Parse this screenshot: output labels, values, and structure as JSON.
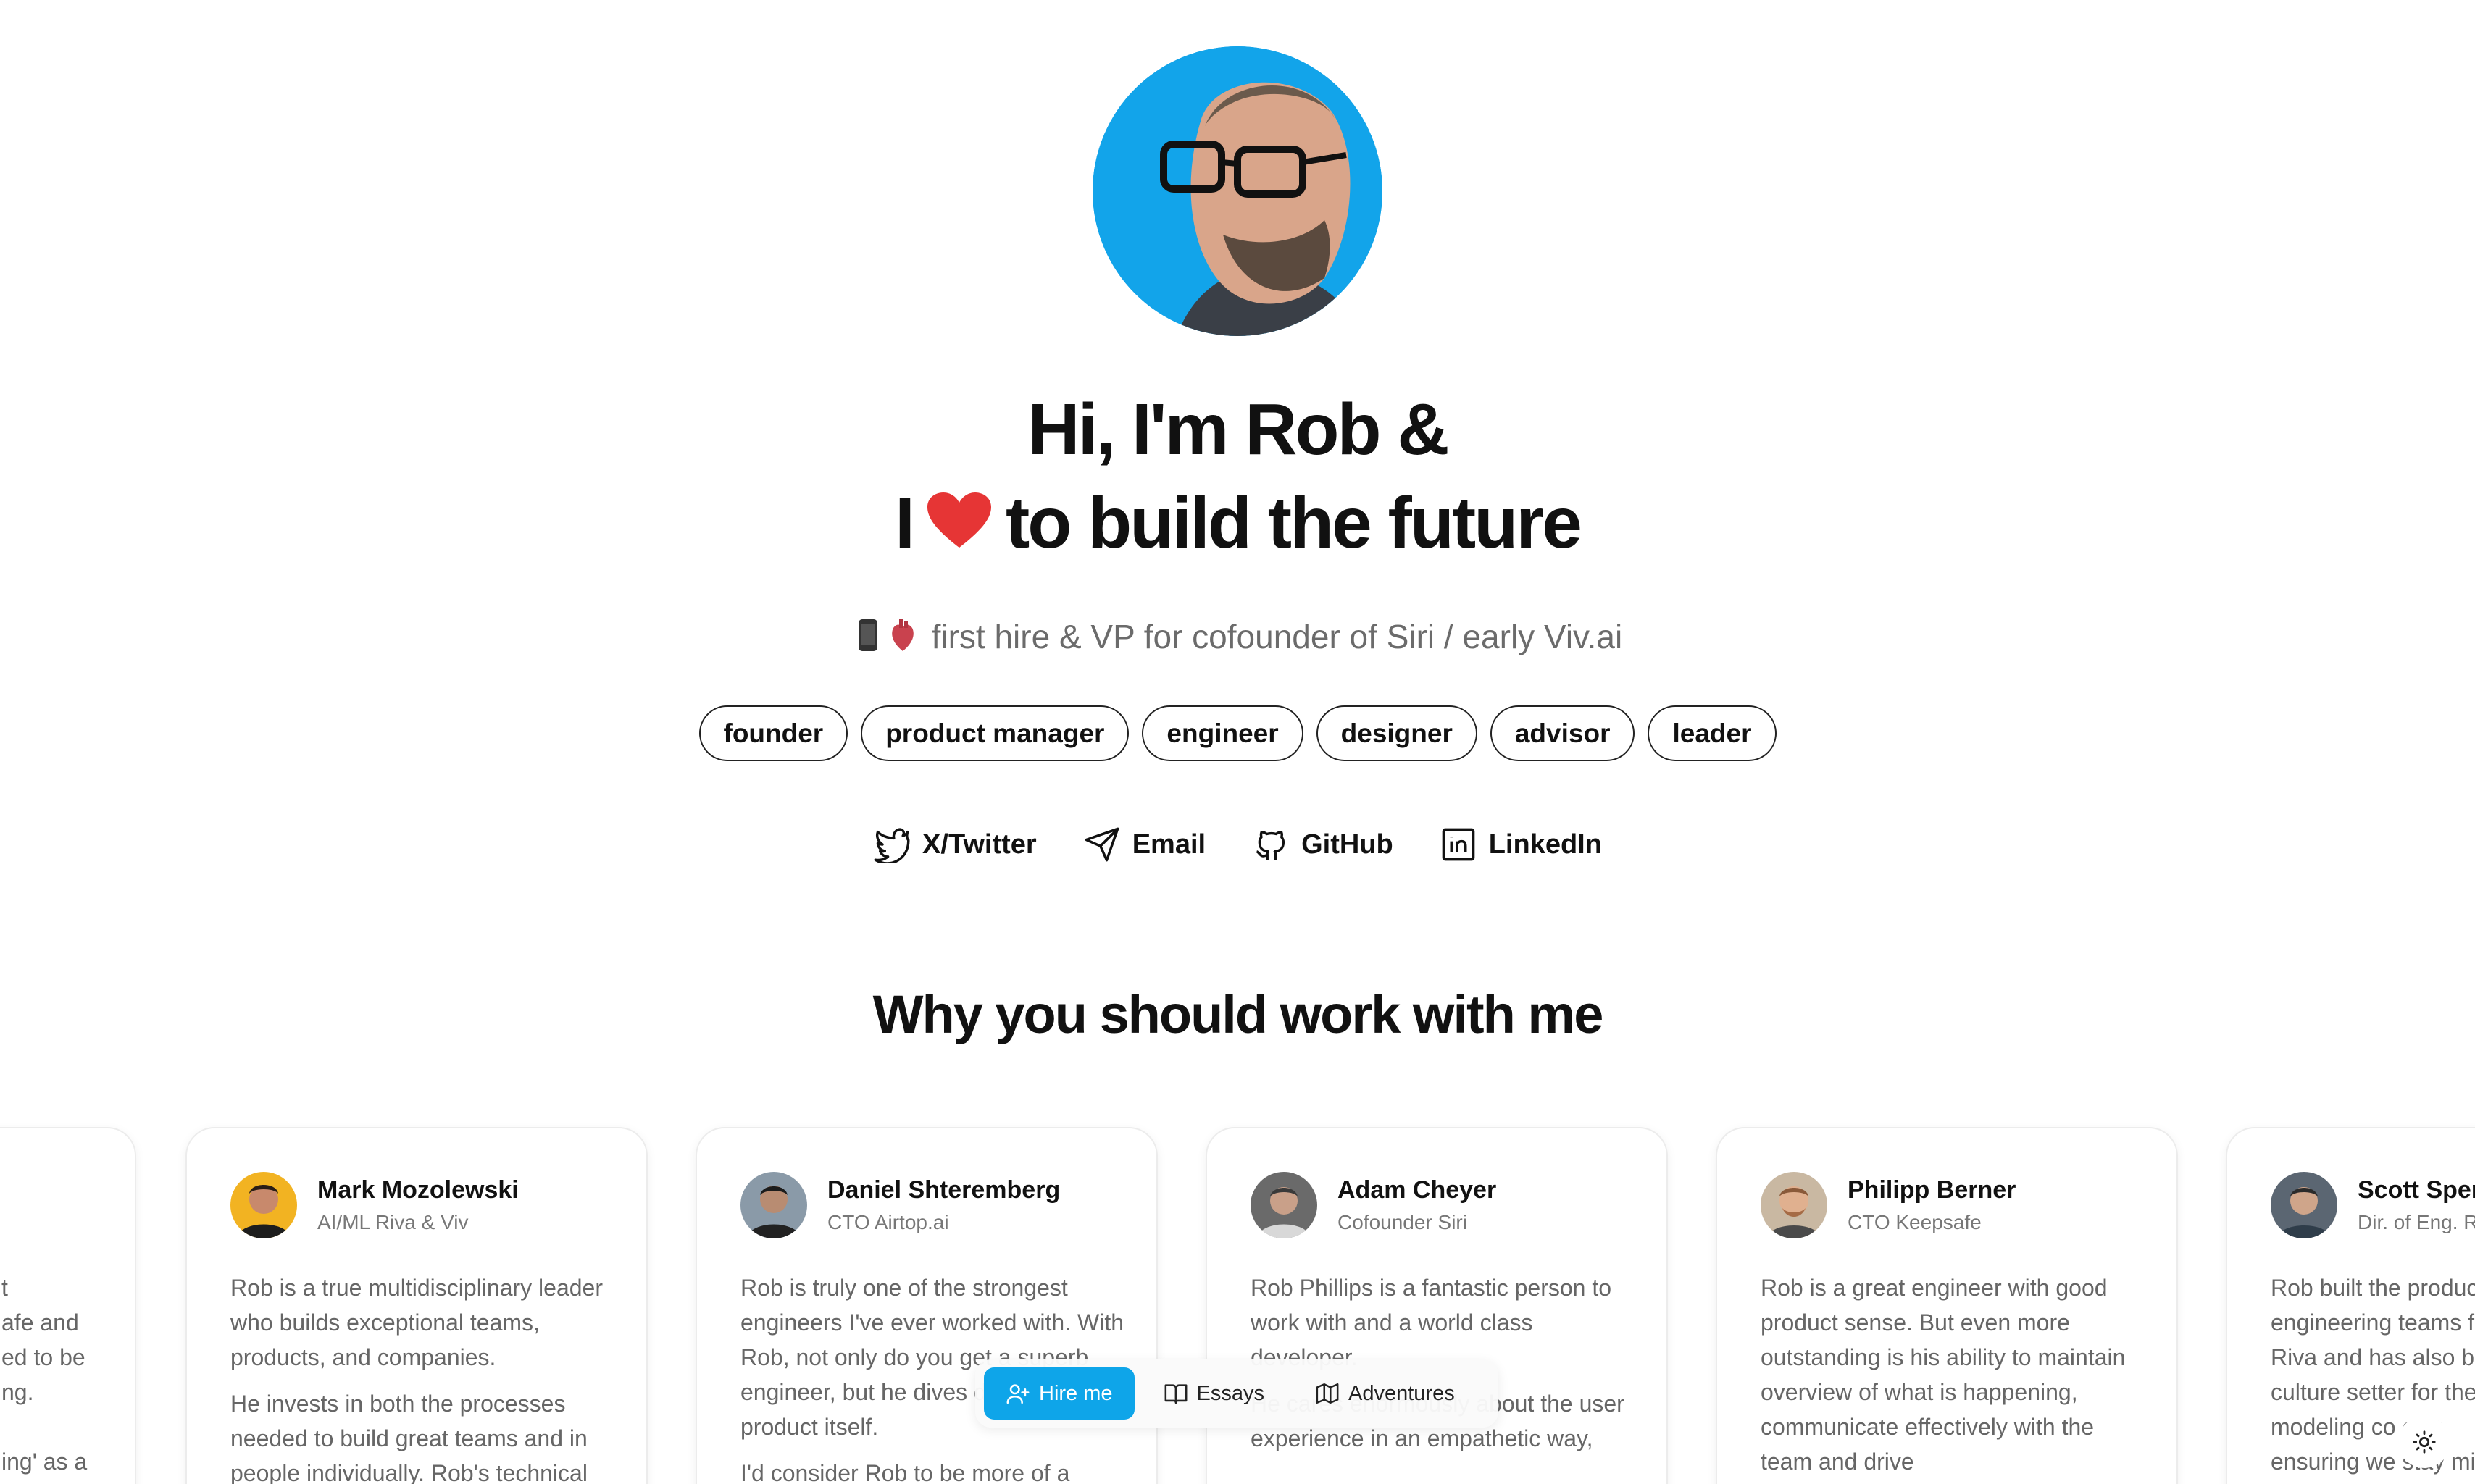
{
  "hero": {
    "headline_line1": "Hi, I'm Rob &",
    "headline_line2_start": "I",
    "headline_line2_mid": "to",
    "headline_highlight": "build the future",
    "heart_icon": "heart-icon",
    "highlight_color": "#55b4ee",
    "subtitle": "first hire & VP for cofounder of Siri / early Viv.ai"
  },
  "roles": [
    "founder",
    "product manager",
    "engineer",
    "designer",
    "advisor",
    "leader"
  ],
  "socials": {
    "twitter": "X/Twitter",
    "email": "Email",
    "github": "GitHub",
    "linkedin": "LinkedIn"
  },
  "section_title": "Why you should work with me",
  "testimonials": [
    {
      "partial_lines": [
        "t",
        "afe and",
        "ed to be",
        "ng.",
        "",
        "ing' as a"
      ]
    },
    {
      "name": "Mark Mozolewski",
      "role": "AI/ML Riva & Viv",
      "quote_p1": "Rob is a true multidisciplinary leader who builds exceptional teams, products, and companies.",
      "quote_p2": "He invests in both the processes needed to build great teams and in people individually. Rob's technical"
    },
    {
      "name": "Daniel Shteremberg",
      "role": "CTO Airtop.ai",
      "quote_p1": "Rob is truly one of the strongest engineers I've ever worked with. With Rob, not only do you get a superb engineer, but he dives deep into the product itself.",
      "quote_p2": "I'd consider Rob to be more of a"
    },
    {
      "name": "Adam Cheyer",
      "role": "Cofounder Siri",
      "quote_p1": "Rob Phillips is a fantastic person to work with and a world class developer.",
      "quote_p2": "He cares enormously about the user experience in an empathetic way,"
    },
    {
      "name": "Philipp Berner",
      "role": "CTO Keepsafe",
      "quote_p1": "Rob is a great engineer with good product sense. But even more outstanding is his ability to maintain overview of what is happening, communicate effectively with the team and drive"
    },
    {
      "name": "Scott Sperl",
      "role": "Dir. of Eng. R",
      "quote_p1": "Rob built the produc engineering teams f Riva and has also be culture setter for the modeling co orat ensuring we stay mi"
    }
  ],
  "nav": {
    "hire": "Hire me",
    "essays": "Essays",
    "adventures": "Adventures"
  },
  "theme_toggle_icon": "sun-icon",
  "accent_color": "#0ea5e9"
}
